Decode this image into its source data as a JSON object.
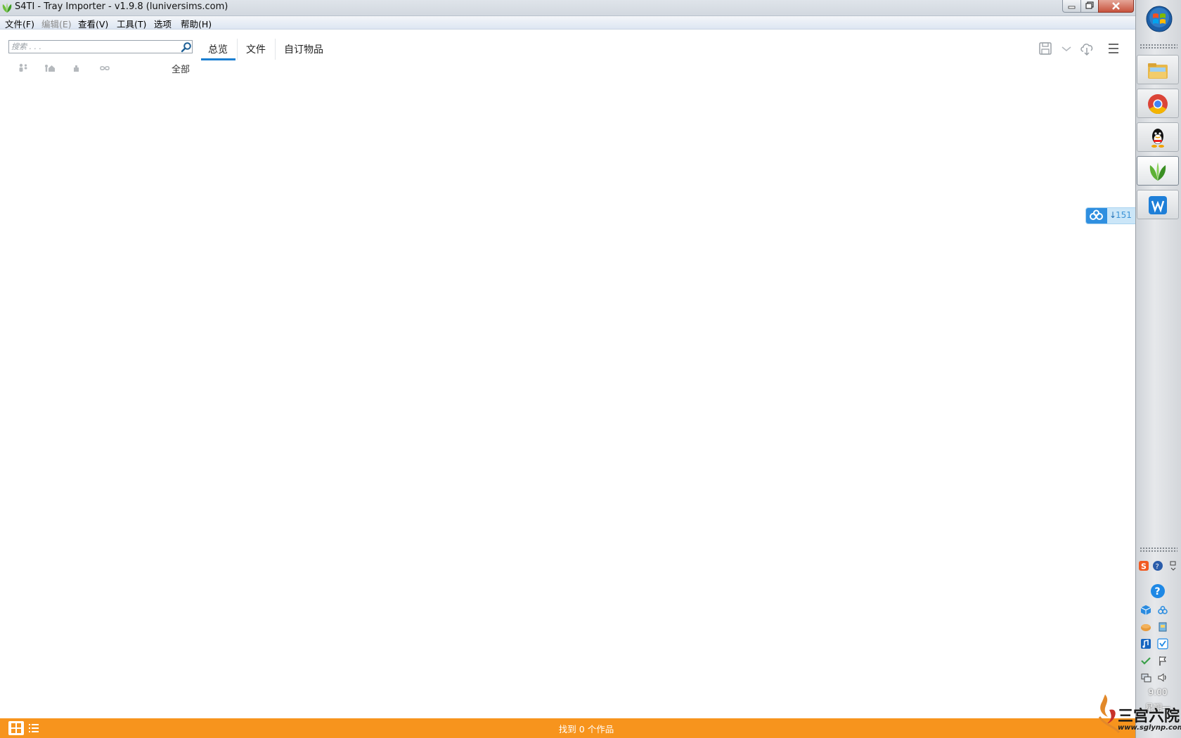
{
  "window": {
    "title": "S4TI - Tray Importer - v1.9.8  (luniversims.com)"
  },
  "menubar": {
    "items": [
      {
        "label": "文件(F)",
        "enabled": true
      },
      {
        "label": "编辑(E)",
        "enabled": false
      },
      {
        "label": "查看(V)",
        "enabled": true
      },
      {
        "label": "工具(T)",
        "enabled": true
      },
      {
        "label": "选项",
        "enabled": true
      },
      {
        "label": "帮助(H)",
        "enabled": true
      }
    ]
  },
  "search": {
    "placeholder": "搜索 . . ."
  },
  "tabs": [
    {
      "label": "总览",
      "active": true
    },
    {
      "label": "文件",
      "active": false
    },
    {
      "label": "自订物品",
      "active": false
    }
  ],
  "filters": {
    "icons": [
      "sims-filter-icon",
      "lots-filter-icon",
      "rooms-filter-icon",
      "infinity-filter-icon"
    ],
    "all_label": "全部"
  },
  "toolbar": {
    "icons": [
      "save-icon",
      "dropdown-chevron-icon",
      "cloud-download-icon",
      "hamburger-menu-icon"
    ]
  },
  "statusbar": {
    "text": "找到 0 个作品",
    "accent": "#f7941d"
  },
  "floating_widget": {
    "count": "151"
  },
  "taskbar": {
    "apps": [
      "file-explorer-icon",
      "chrome-icon",
      "qq-icon",
      "s4ti-leaf-icon",
      "wps-icon"
    ],
    "clock_time": "9:00",
    "clock_day": "星期一"
  },
  "watermark": {
    "text": "三宫六院",
    "url": "www.sglynp.com"
  },
  "colors": {
    "tab_underline": "#1b7fd1",
    "status_orange": "#f7941d",
    "cloud_blue": "#2f8fe0"
  }
}
